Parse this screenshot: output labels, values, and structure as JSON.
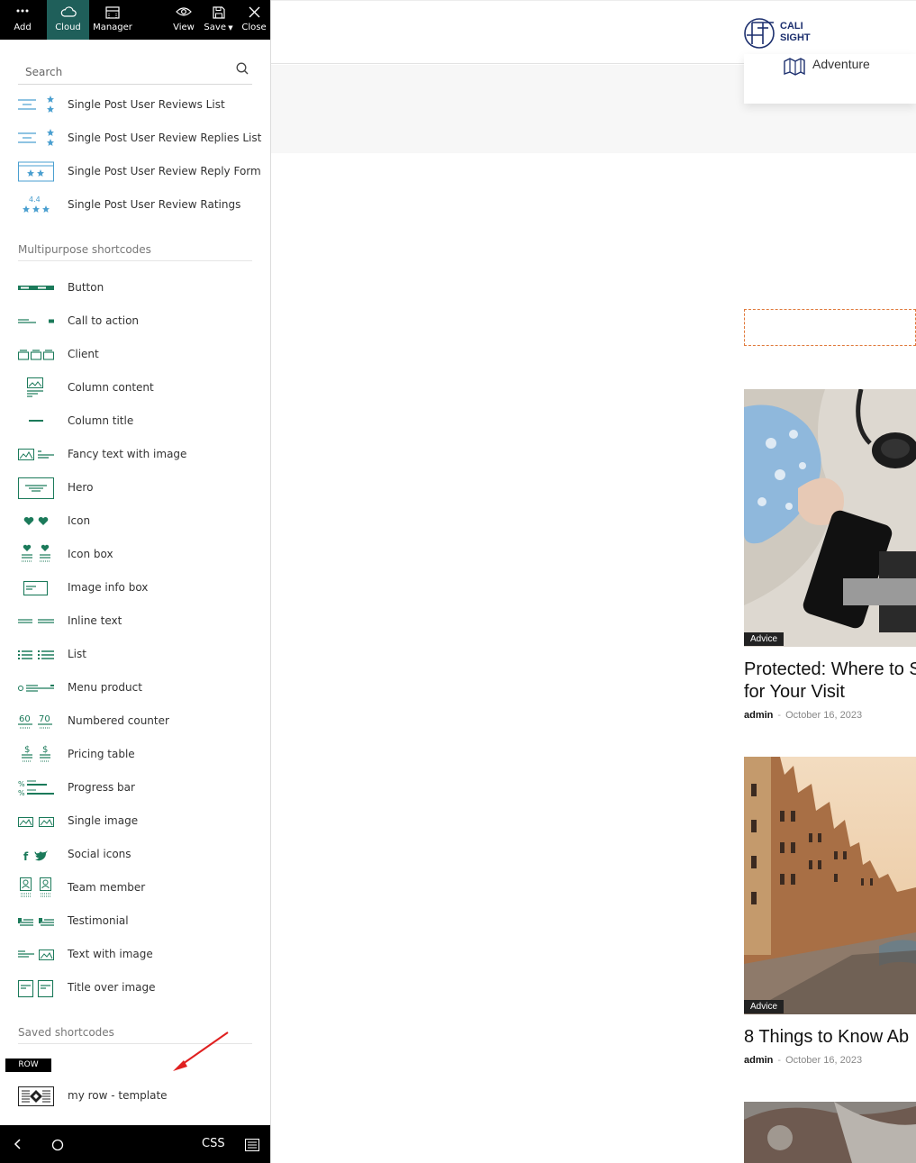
{
  "toolbar": {
    "add": "Add",
    "cloud": "Cloud",
    "manager": "Manager",
    "view": "View",
    "save": "Save",
    "close": "Close"
  },
  "search": {
    "placeholder": "Search"
  },
  "review_items": [
    "Single Post User Reviews List",
    "Single Post User Review Replies List",
    "Single Post User Review Reply Form",
    "Single Post User Review Ratings"
  ],
  "sections": {
    "multipurpose": "Multipurpose shortcodes",
    "saved": "Saved shortcodes"
  },
  "shortcodes": [
    "Button",
    "Call to action",
    "Client",
    "Column content",
    "Column title",
    "Fancy text with image",
    "Hero",
    "Icon",
    "Icon box",
    "Image info box",
    "Inline text",
    "List",
    "Menu product",
    "Numbered counter",
    "Pricing table",
    "Progress bar",
    "Single image",
    "Social icons",
    "Team member",
    "Testimonial",
    "Text with image",
    "Title over image"
  ],
  "saved": {
    "badge": "ROW",
    "item": "my row - template"
  },
  "bottombar": {
    "css": "CSS"
  },
  "site": {
    "logo_line1": "CALI",
    "logo_line2": "SIGHT",
    "dropdown_item": "Adventure",
    "posts": [
      {
        "category": "Advice",
        "title_line1": "Protected: Where to S",
        "title_line2": "for Your Visit",
        "author": "admin",
        "sep": "-",
        "date": "October 16, 2023"
      },
      {
        "category": "Advice",
        "title_line1": "8 Things to Know Ab",
        "author": "admin",
        "sep": "-",
        "date": "October 16, 2023"
      }
    ]
  },
  "colors": {
    "icon_green": "#1b7a5a",
    "review_blue": "#4a9fd0",
    "toolbar_bg": "#000000",
    "cloud_active": "#1f5f5a",
    "accent_orange": "#e07a3c",
    "logo_blue": "#1c2f6e"
  }
}
